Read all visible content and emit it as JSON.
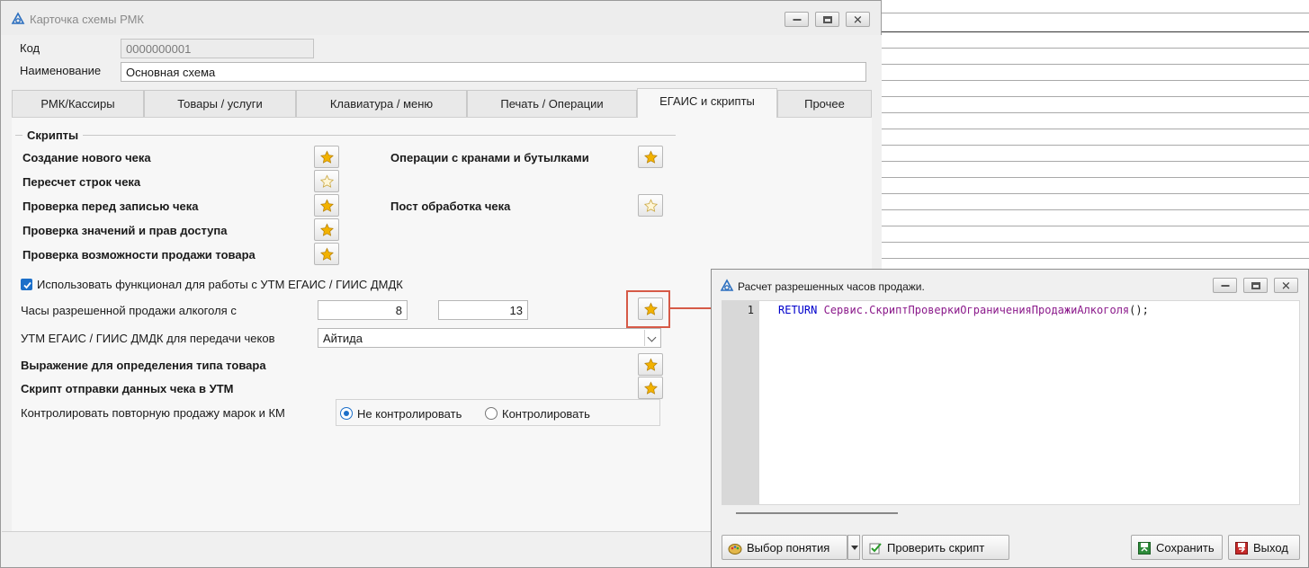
{
  "main_window": {
    "title": "Карточка схемы РМК",
    "code_label": "Код",
    "code_value": "0000000001",
    "name_label": "Наименование",
    "name_value": "Основная схема",
    "tabs": [
      {
        "label": "РМК/Кассиры",
        "active": false
      },
      {
        "label": "Товары / услуги",
        "active": false
      },
      {
        "label": "Клавиатура / меню",
        "active": false
      },
      {
        "label": "Печать / Операции",
        "active": false
      },
      {
        "label": "ЕГАИС и скрипты",
        "active": true
      },
      {
        "label": "Прочее",
        "active": false
      }
    ],
    "scripts_group_title": "Скрипты",
    "scripts_left": [
      {
        "label": "Создание нового чека",
        "filled": true
      },
      {
        "label": "Пересчет строк чека",
        "filled": false
      },
      {
        "label": "Проверка перед записью чека",
        "filled": true
      },
      {
        "label": "Проверка значений и прав доступа",
        "filled": true
      },
      {
        "label": "Проверка возможности продажи товара",
        "filled": true
      }
    ],
    "scripts_right": [
      {
        "label": "Операции с кранами и бутылками",
        "filled": true
      },
      {
        "label": "Пост обработка чека",
        "filled": false
      }
    ],
    "use_egais_label": "Использовать функционал для работы с УТМ ЕГАИС / ГИИС ДМДК",
    "use_egais_checked": true,
    "alcohol_hours_label": "Часы разрешенной продажи алкоголя с",
    "alcohol_hours_from": "8",
    "alcohol_hours_to": "13",
    "utm_label": "УТМ ЕГАИС / ГИИС ДМДК для передачи чеков",
    "utm_value": "Айтида",
    "expression_label": "Выражение для определения типа товара",
    "send_script_label": "Скрипт отправки данных чека в УТМ",
    "control_label": "Контролировать повторную продажу марок и КМ",
    "control_options": [
      {
        "label": "Не контролировать",
        "selected": true
      },
      {
        "label": "Контролировать",
        "selected": false
      }
    ]
  },
  "dialog": {
    "title": "Расчет разрешенных часов продажи.",
    "line_number": "1",
    "code_keyword": "RETURN",
    "code_call": "Сервис.СкриптПроверкиОграниченияПродажиАлкоголя",
    "code_tail": "();",
    "buttons": {
      "select_concept": "Выбор понятия",
      "check_script": "Проверить скрипт",
      "save": "Сохранить",
      "exit": "Выход"
    }
  },
  "colors": {
    "accent": "#1c6fc9",
    "highlight": "#d65a47",
    "star": "#f2b200",
    "keyword": "#0000cc",
    "function": "#8b1a8b"
  }
}
